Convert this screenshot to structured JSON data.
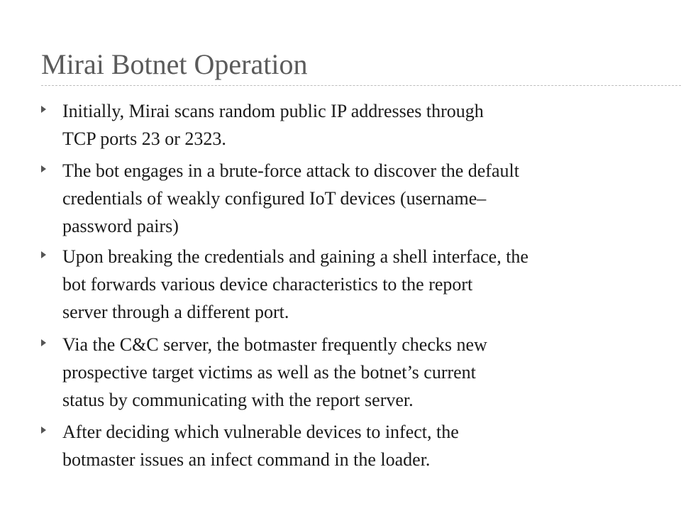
{
  "slide": {
    "title": "Mirai Botnet Operation",
    "bullet_icon": "triangle-bullet-icon",
    "colors": {
      "title": "#5a5a5a",
      "text": "#1a1a1a",
      "bullet": "#555555",
      "divider": "#bdbdbd",
      "background": "#ffffff"
    },
    "bullets": [
      {
        "lines": [
          "Initially,  Mirai  scans  random  public IP  addresses  through",
          "TCP  ports  23 or  2323."
        ]
      },
      {
        "lines": [
          "The bot engages in a brute-force attack to discover the default",
          "credentials of weakly configured IoT devices (username–",
          "password pairs)"
        ]
      },
      {
        "lines": [
          "Upon  breaking the credentials and gaining a shell interface, the",
          "bot forwards various device characteristics  to  the  report",
          "server through a different port."
        ]
      },
      {
        "lines": [
          "Via  the  C&C  server,  the  botmaster  frequently  checks  new",
          "prospective  target  victims  as  well  as  the botnet’s  current",
          "status  by  communicating  with the report server."
        ]
      },
      {
        "lines": [
          "After deciding which vulnerable devices to infect, the",
          "botmaster issues an infect command  in the loader."
        ]
      }
    ]
  }
}
